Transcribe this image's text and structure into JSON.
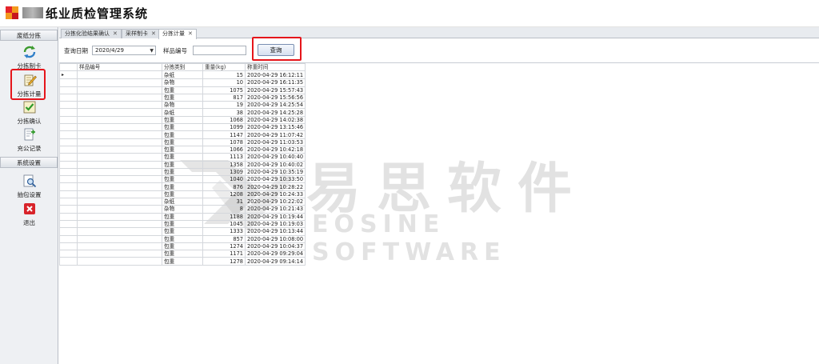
{
  "app": {
    "title": "纸业质检管理系统"
  },
  "sidebar": {
    "groups": [
      {
        "label": "废纸分拣"
      },
      {
        "label": "系统设置"
      }
    ],
    "items": [
      {
        "label": "分拣制卡",
        "icon": "refresh-icon"
      },
      {
        "label": "分拣计量",
        "icon": "edit-icon"
      },
      {
        "label": "分拣确认",
        "icon": "check-icon"
      },
      {
        "label": "充公记录",
        "icon": "document-add-icon"
      },
      {
        "label": "抽包设置",
        "icon": "search-document-icon"
      },
      {
        "label": "退出",
        "icon": "close-icon"
      }
    ]
  },
  "tabs": [
    {
      "label": "分拣化验结果确认",
      "close": "✕"
    },
    {
      "label": "采样制卡",
      "close": "✕"
    },
    {
      "label": "分拣计量",
      "close": "✕"
    }
  ],
  "query": {
    "date_label": "查询日期",
    "date_value": "2020/4/29",
    "sample_label": "样品编号",
    "sample_value": "",
    "button_label": "查询"
  },
  "grid": {
    "columns": [
      "样品编号",
      "分拣类别",
      "重量(kg)",
      "称重时间"
    ],
    "rows": [
      [
        "",
        "杂纸",
        "15",
        "2020-04-29 16:12:11"
      ],
      [
        "",
        "杂物",
        "10",
        "2020-04-29 16:11:35"
      ],
      [
        "",
        "包重",
        "1075",
        "2020-04-29 15:57:43"
      ],
      [
        "",
        "包重",
        "817",
        "2020-04-29 15:56:56"
      ],
      [
        "",
        "杂物",
        "19",
        "2020-04-29 14:25:54"
      ],
      [
        "",
        "杂纸",
        "38",
        "2020-04-29 14:25:28"
      ],
      [
        "",
        "包重",
        "1068",
        "2020-04-29 14:02:38"
      ],
      [
        "",
        "包重",
        "1099",
        "2020-04-29 13:15:46"
      ],
      [
        "",
        "包重",
        "1147",
        "2020-04-29 11:07:42"
      ],
      [
        "",
        "包重",
        "1078",
        "2020-04-29 11:03:53"
      ],
      [
        "",
        "包重",
        "1066",
        "2020-04-29 10:42:18"
      ],
      [
        "",
        "包重",
        "1113",
        "2020-04-29 10:40:40"
      ],
      [
        "",
        "包重",
        "1358",
        "2020-04-29 10:40:02"
      ],
      [
        "",
        "包重",
        "1309",
        "2020-04-29 10:35:19"
      ],
      [
        "",
        "包重",
        "1040",
        "2020-04-29 10:33:50"
      ],
      [
        "",
        "包重",
        "876",
        "2020-04-29 10:28:22"
      ],
      [
        "",
        "包重",
        "1208",
        "2020-04-29 10:24:33"
      ],
      [
        "",
        "杂纸",
        "31",
        "2020-04-29 10:22:02"
      ],
      [
        "",
        "杂物",
        "8",
        "2020-04-29 10:21:43"
      ],
      [
        "",
        "包重",
        "1188",
        "2020-04-29 10:19:44"
      ],
      [
        "",
        "包重",
        "1045",
        "2020-04-29 10:19:03"
      ],
      [
        "",
        "包重",
        "1333",
        "2020-04-29 10:13:44"
      ],
      [
        "",
        "包重",
        "857",
        "2020-04-29 10:08:00"
      ],
      [
        "",
        "包重",
        "1274",
        "2020-04-29 10:04:37"
      ],
      [
        "",
        "包重",
        "1171",
        "2020-04-29 09:29:04"
      ],
      [
        "",
        "包重",
        "1278",
        "2020-04-29 09:14:14"
      ]
    ]
  },
  "watermark": {
    "cn": "易思软件",
    "en": "EOSINE SOFTWARE"
  },
  "colors": {
    "highlight": "#e5151b",
    "logo_red": "#e5242b",
    "logo_orange": "#f39a1e"
  }
}
